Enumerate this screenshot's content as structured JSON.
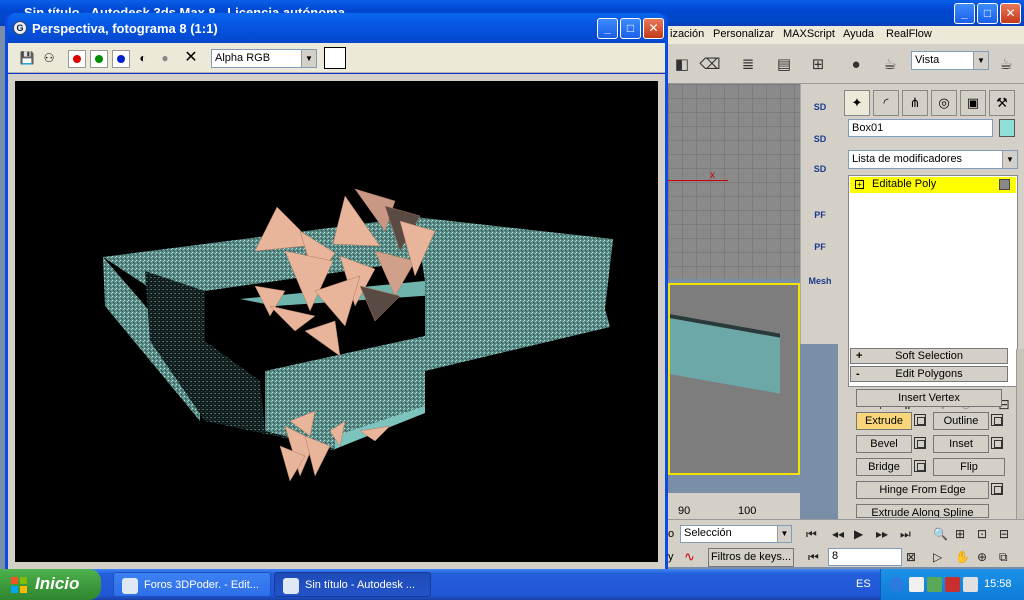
{
  "main_window": {
    "title": "Sin título - Autodesk 3ds Max 8 - Licencia autónoma",
    "minimize": "_",
    "maximize": "□",
    "close": "✕"
  },
  "menubar": {
    "items": [
      "ización",
      "Personalizar",
      "MAXScript",
      "Ayuda",
      "RealFlow"
    ]
  },
  "toolbar": {
    "viewport_select": "Vista"
  },
  "viewport_top": {
    "axis_label": "x"
  },
  "ruler": {
    "ticks": [
      "90",
      "100"
    ]
  },
  "command_strip": {
    "buttons": [
      "SD",
      "SD",
      "SD",
      "PF",
      "PF",
      "Mesh"
    ]
  },
  "command_panel": {
    "object_name": "Box01",
    "object_color": "#8fe0d8",
    "modifier_list": "Lista de modificadores",
    "stack_item": "Editable Poly",
    "rollouts": {
      "soft_selection": "Soft Selection",
      "edit_polygons": "Edit Polygons"
    },
    "buttons": {
      "insert_vertex": "Insert Vertex",
      "extrude": "Extrude",
      "outline": "Outline",
      "bevel": "Bevel",
      "inset": "Inset",
      "bridge": "Bridge",
      "flip": "Flip",
      "hinge": "Hinge From Edge",
      "extrude_spline": "Extrude Along Spline"
    }
  },
  "bottom": {
    "selection_set": "Selección",
    "key_filters": "Filtros de keys...",
    "current_frame": "8",
    "left_letters": [
      "o",
      "y"
    ]
  },
  "render_window": {
    "title": "Perspectiva, fotograma 8 (1:1)",
    "channel": "Alpha RGB",
    "channel_dots": [
      "#e00000",
      "#008c00",
      "#0020d0"
    ]
  },
  "taskbar": {
    "start": "Inicio",
    "tasks": [
      "Foros 3DPoder. - Edit...",
      "Sin título - Autodesk ..."
    ],
    "language": "ES",
    "clock": "15:58"
  }
}
